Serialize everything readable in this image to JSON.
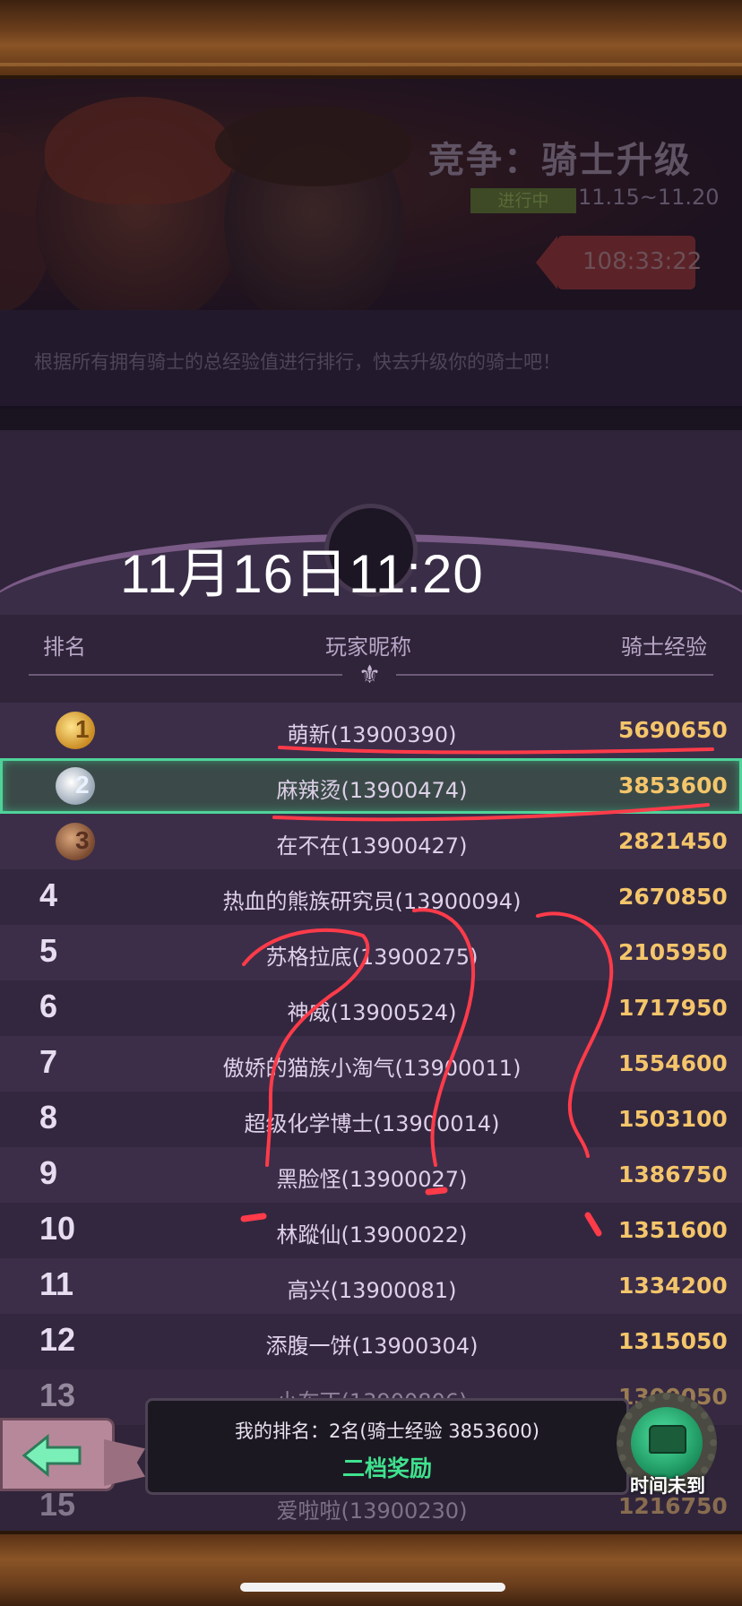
{
  "banner": {
    "title": "竞争：骑士升级",
    "status": "进行中",
    "date_range": "11.15~11.20",
    "countdown": "108:33:22"
  },
  "description": "根据所有拥有骑士的总经验值进行排行，快去升级你的骑士吧！",
  "overlay_time": "11月16日11:20",
  "table": {
    "headers": {
      "rank": "排名",
      "nickname": "玩家昵称",
      "exp": "骑士经验"
    },
    "rows": [
      {
        "rank": "1",
        "name": "萌新(13900390)",
        "exp": "5690650"
      },
      {
        "rank": "2",
        "name": "麻辣烫(13900474)",
        "exp": "3853600"
      },
      {
        "rank": "3",
        "name": "在不在(13900427)",
        "exp": "2821450"
      },
      {
        "rank": "4",
        "name": "热血的熊族研究员(13900094)",
        "exp": "2670850"
      },
      {
        "rank": "5",
        "name": "苏格拉底(13900275)",
        "exp": "2105950"
      },
      {
        "rank": "6",
        "name": "神威(13900524)",
        "exp": "1717950"
      },
      {
        "rank": "7",
        "name": "傲娇的猫族小淘气(13900011)",
        "exp": "1554600"
      },
      {
        "rank": "8",
        "name": "超级化学博士(13900014)",
        "exp": "1503100"
      },
      {
        "rank": "9",
        "name": "黑脸怪(13900027)",
        "exp": "1386750"
      },
      {
        "rank": "10",
        "name": "林蹤仙(13900022)",
        "exp": "1351600"
      },
      {
        "rank": "11",
        "name": "高兴(13900081)",
        "exp": "1334200"
      },
      {
        "rank": "12",
        "name": "添腹一饼(13900304)",
        "exp": "1315050"
      },
      {
        "rank": "13",
        "name": "小布丁(13900806)",
        "exp": "1300050"
      },
      {
        "rank": "15",
        "name": "爱啦啦(13900230)",
        "exp": "1216750"
      }
    ]
  },
  "my_rank": {
    "text": "我的排名：2名(骑士经验 3853600)",
    "reward": "二档奖励"
  },
  "chest_button": {
    "label": "时间未到"
  },
  "colors": {
    "highlight": "#4fd39a",
    "exp": "#f4c56a",
    "reward": "#3fe28e",
    "annotation": "#ff3b4a"
  },
  "icons": {
    "back": "back-arrow-icon",
    "chest": "treasure-chest-icon",
    "fleur": "fleur-de-lis-icon"
  }
}
